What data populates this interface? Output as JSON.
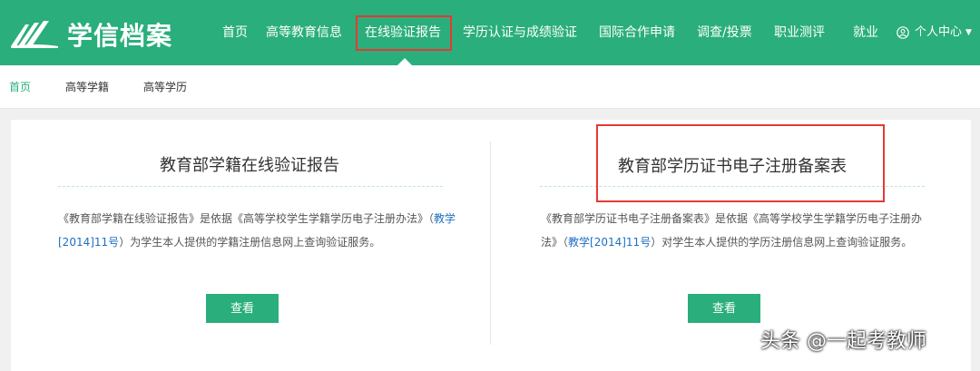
{
  "header": {
    "logo_text": "学信档案",
    "nav": [
      "首页",
      "高等教育信息",
      "在线验证报告",
      "学历认证与成绩验证",
      "国际合作申请",
      "调查/投票",
      "职业测评",
      "就业"
    ],
    "user_menu": "个人中心"
  },
  "breadcrumb": [
    "首页",
    "高等学籍",
    "高等学历"
  ],
  "cards": [
    {
      "title": "教育部学籍在线验证报告",
      "desc_before": "《教育部学籍在线验证报告》是依据《高等学校学生学籍学历电子注册办法》（",
      "desc_link": "教学[2014]11号",
      "desc_after": "）为学生本人提供的学籍注册信息网上查询验证服务。",
      "button": "查看"
    },
    {
      "title": "教育部学历证书电子注册备案表",
      "desc_before": "《教育部学历证书电子注册备案表》是依据《高等学校学生学籍学历电子注册办法》（",
      "desc_link": "教学[2014]11号",
      "desc_after": "）对学生本人提供的学历注册信息网上查询验证服务。",
      "button": "查看"
    }
  ],
  "watermark": "头条 @一起考教师",
  "colors": {
    "brand_green": "#2aae7b",
    "highlight_red": "#e53935",
    "link_blue": "#1f6fc2"
  }
}
